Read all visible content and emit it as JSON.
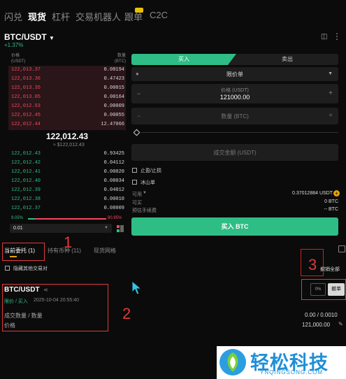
{
  "topnav": {
    "items": [
      "闪兑",
      "现货",
      "杠杆",
      "交易机器人",
      "跟单",
      "C2C"
    ]
  },
  "pair": {
    "symbol": "BTC/USDT",
    "change": "+1.37%"
  },
  "orderbook": {
    "price_header": "价格",
    "price_unit": "(USDT)",
    "qty_header": "数量",
    "qty_unit": "(BTC)",
    "asks": [
      {
        "p": "122,013.37",
        "q": "0.08194"
      },
      {
        "p": "122,013.36",
        "q": "0.47423"
      },
      {
        "p": "122,013.35",
        "q": "0.00015"
      },
      {
        "p": "122,013.05",
        "q": "0.00164"
      },
      {
        "p": "122,012.53",
        "q": "0.00009"
      },
      {
        "p": "122,012.45",
        "q": "0.00055"
      },
      {
        "p": "122,012.44",
        "q": "12.47066"
      }
    ],
    "mid_price": "122,012.43",
    "mid_sub": "≈ $122,012.43",
    "bids": [
      {
        "p": "122,012.43",
        "q": "0.93425"
      },
      {
        "p": "122,012.42",
        "q": "0.04112"
      },
      {
        "p": "122,012.41",
        "q": "0.00020"
      },
      {
        "p": "122,012.40",
        "q": "0.08034"
      },
      {
        "p": "122,012.39",
        "q": "0.04012"
      },
      {
        "p": "122,012.38",
        "q": "0.00010"
      },
      {
        "p": "122,012.37",
        "q": "0.08009"
      }
    ],
    "buy_pct": "9.05%",
    "sell_pct": "90.95%",
    "precision": "0.01"
  },
  "trade": {
    "buy_tab": "买入",
    "sell_tab": "卖出",
    "order_type": "限价单",
    "price_label": "价格 (USDT)",
    "price_value": "121000.00",
    "qty_placeholder": "数量 (BTC)",
    "total_placeholder": "成交金额 (USDT)",
    "tpsl_label": "止盈/止损",
    "iceberg_label": "冰山单",
    "available_label": "可用",
    "available_value": "0.37012884 USDT",
    "buyable_label": "可买",
    "buyable_value": "0 BTC",
    "fee_label": "预估手续费",
    "fee_value": "-- BTC",
    "buy_button": "买入 BTC"
  },
  "orders": {
    "tabs": [
      "当前委托 (1)",
      "持有币种 (11)",
      "现货网格"
    ],
    "hide_others": "隐藏其他交易对",
    "cancel_all": "撤销全部",
    "item": {
      "symbol": "BTC/USDT",
      "type_line": "限价 / 买入",
      "time": "2025-10-04 20:55:40",
      "filled_label": "成交数量 / 数量",
      "filled_value": "0.00 / 0.0010",
      "price_label": "价格",
      "price_value": "121,000.00",
      "progress": "0%",
      "cancel_button": "撤单"
    }
  },
  "annotations": {
    "n1": "1",
    "n2": "2",
    "n3": "3"
  },
  "logo": {
    "text": "轻松科技",
    "sub": "YNQINGSONG.COM"
  },
  "colors": {
    "green": "#2ebd85",
    "red": "#f6465d",
    "annotation": "#e03a3a",
    "logo_blue": "#1f8fd8"
  }
}
